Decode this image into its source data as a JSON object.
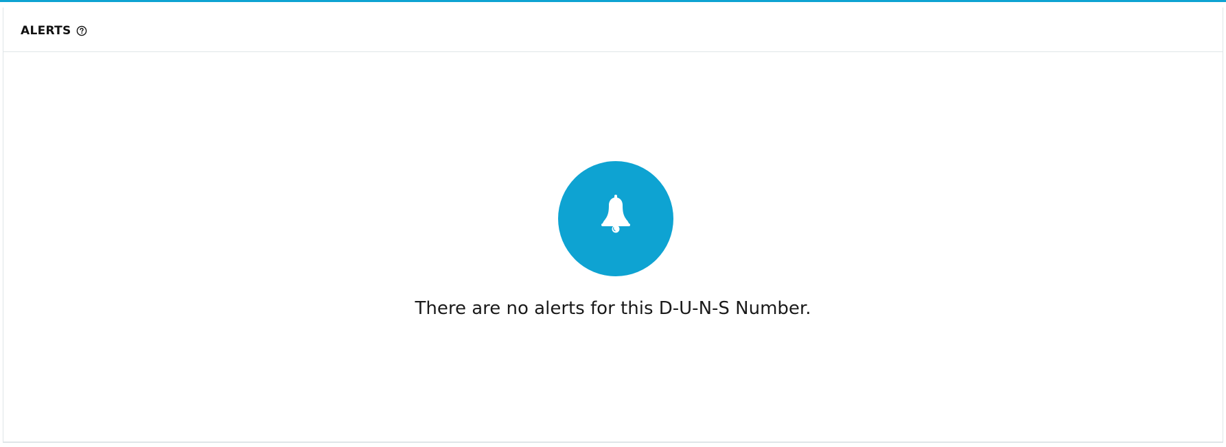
{
  "panel": {
    "title": "ALERTS",
    "help_icon": "question-circle-icon",
    "accent_color": "#0ea3d2"
  },
  "empty_state": {
    "icon": "bell-icon",
    "icon_background": "#0ea3d2",
    "message": "There are no alerts for this D-U-N-S Number."
  }
}
